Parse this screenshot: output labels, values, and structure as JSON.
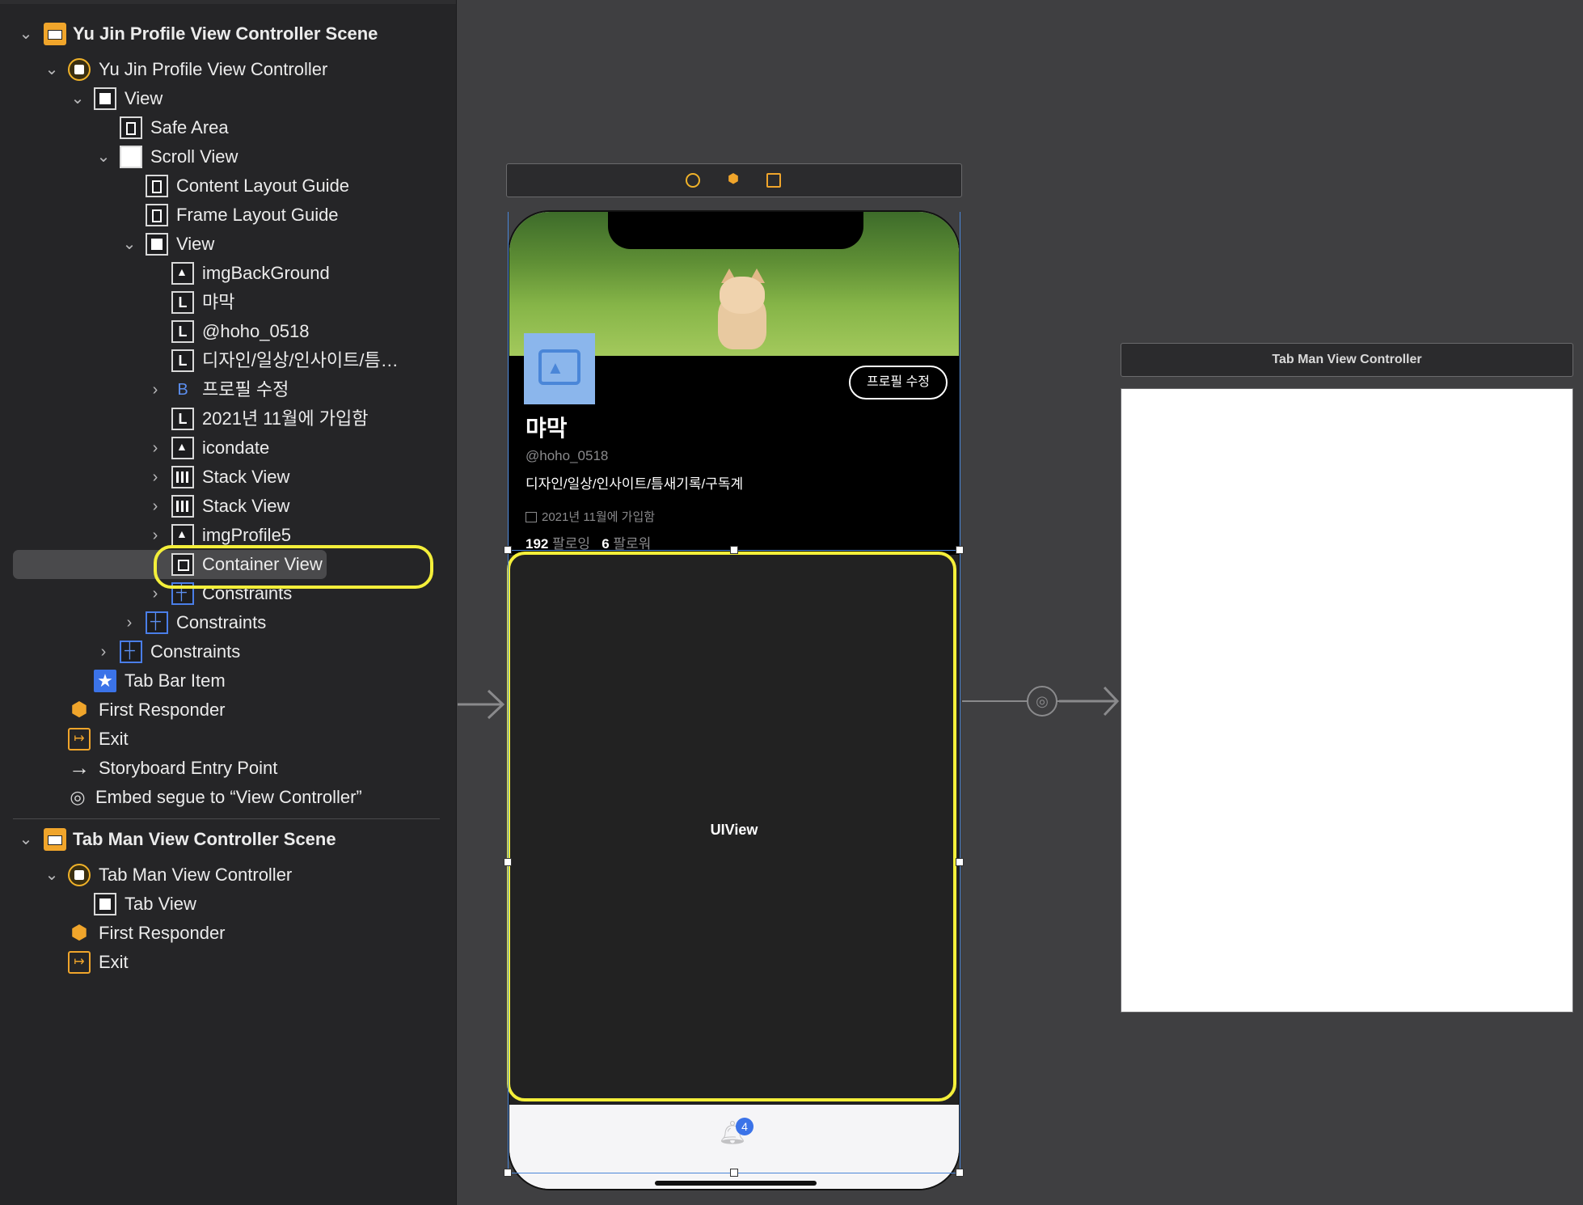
{
  "outline": {
    "items": [
      {
        "label": "Yu Jin Profile View Controller Scene",
        "icon": "scene-icon"
      },
      {
        "label": "Yu Jin Profile View Controller",
        "icon": "view-controller-icon"
      },
      {
        "label": "View",
        "icon": "view-icon"
      },
      {
        "label": "Safe Area",
        "icon": "layout-guide-icon"
      },
      {
        "label": "Scroll View",
        "icon": "scroll-view-icon"
      },
      {
        "label": "Content Layout Guide",
        "icon": "layout-guide-icon"
      },
      {
        "label": "Frame Layout Guide",
        "icon": "layout-guide-icon"
      },
      {
        "label": "View",
        "icon": "view-icon"
      },
      {
        "label": "imgBackGround",
        "icon": "image-view-icon"
      },
      {
        "label": "먀막",
        "icon": "label-icon"
      },
      {
        "label": "@hoho_0518",
        "icon": "label-icon"
      },
      {
        "label": "디자인/일상/인사이트/틈…",
        "icon": "label-icon"
      },
      {
        "label": "프로필 수정",
        "icon": "button-icon"
      },
      {
        "label": "2021년 11월에 가입함",
        "icon": "label-icon"
      },
      {
        "label": "icondate",
        "icon": "image-view-icon"
      },
      {
        "label": "Stack View",
        "icon": "stack-view-icon"
      },
      {
        "label": "Stack View",
        "icon": "stack-view-icon"
      },
      {
        "label": "imgProfile5",
        "icon": "image-view-icon"
      },
      {
        "label": "Container View",
        "icon": "container-view-icon"
      },
      {
        "label": "Constraints",
        "icon": "constraints-icon"
      },
      {
        "label": "Constraints",
        "icon": "constraints-icon"
      },
      {
        "label": "Constraints",
        "icon": "constraints-icon"
      },
      {
        "label": "Tab Bar Item",
        "icon": "tab-bar-item-icon"
      },
      {
        "label": "First Responder",
        "icon": "first-responder-icon"
      },
      {
        "label": "Exit",
        "icon": "exit-icon"
      },
      {
        "label": "Storyboard Entry Point",
        "icon": "entry-arrow-icon"
      },
      {
        "label": "Embed segue to “View Controller”",
        "icon": "segue-icon"
      },
      {
        "label": "Tab Man View Controller Scene",
        "icon": "scene-icon"
      },
      {
        "label": "Tab Man View Controller",
        "icon": "view-controller-icon"
      },
      {
        "label": "Tab View",
        "icon": "view-icon"
      },
      {
        "label": "First Responder",
        "icon": "first-responder-icon"
      },
      {
        "label": "Exit",
        "icon": "exit-icon"
      }
    ]
  },
  "canvas": {
    "profile": {
      "name": "먀막",
      "handle": "@hoho_0518",
      "bio": "디자인/일상/인사이트/틈새기록/구독계",
      "joined": "2021년 11월에 가입함",
      "following_count": "192",
      "following_label": "팔로잉",
      "followers_count": "6",
      "followers_label": "팔로워",
      "edit_button": "프로필 수정"
    },
    "container_label": "UIView",
    "badge_count": "4",
    "tabman_title": "Tab Man View Controller"
  },
  "colors": {
    "selection": "#f4ef3a",
    "scene_icon": "#f0a52b",
    "accent_blue": "#3b73e8"
  }
}
